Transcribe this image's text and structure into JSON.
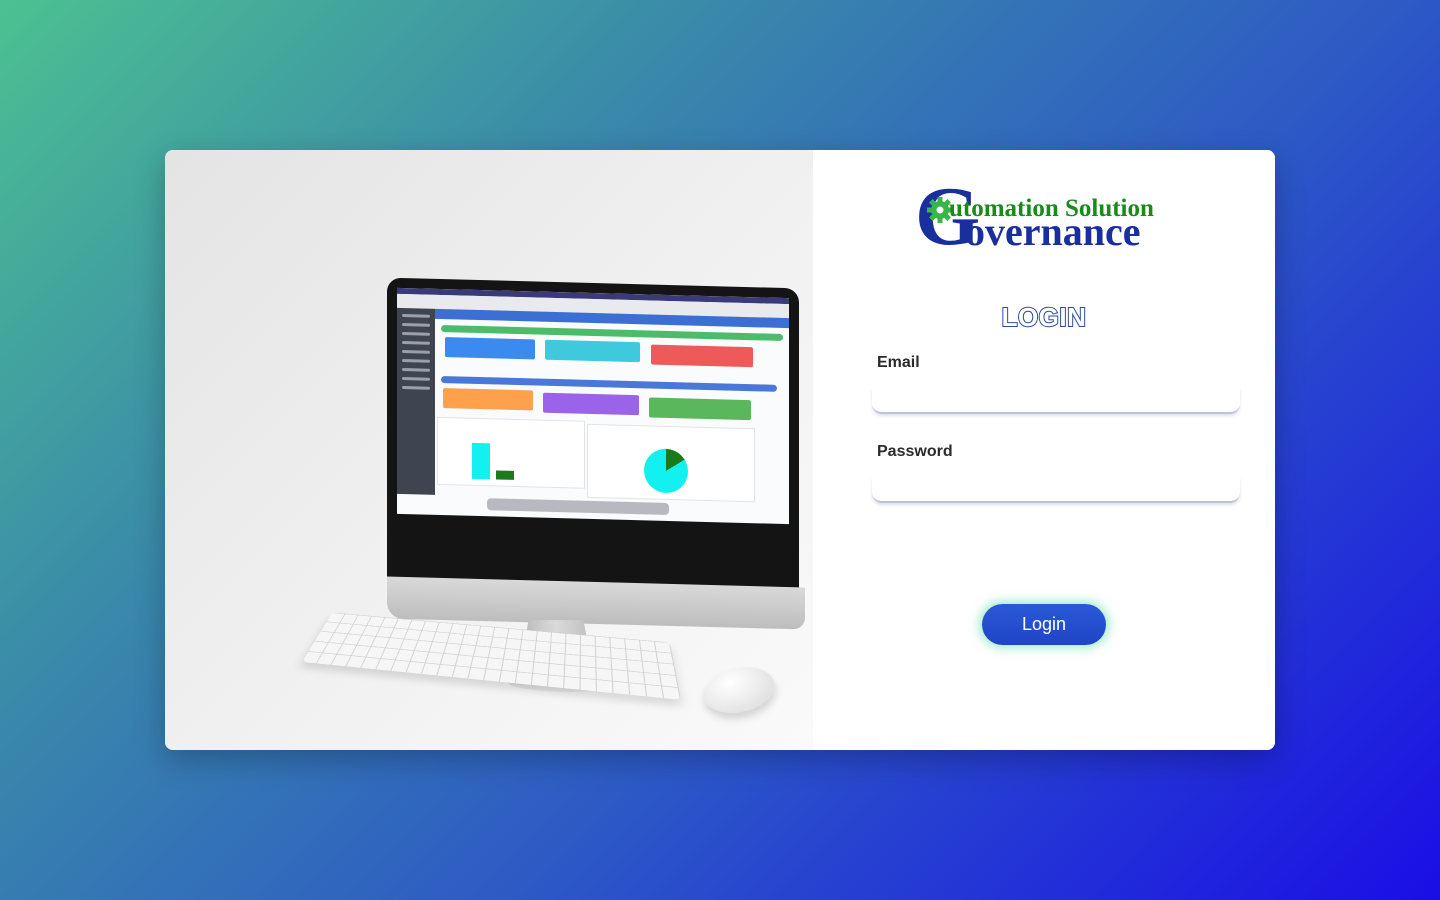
{
  "logo": {
    "line1": "utomation Solution",
    "line2": "overnance",
    "big_letter": "G",
    "line1_color": "#1a8a1a",
    "line2_color": "#1a2f9e",
    "gear_color": "#3ab54a"
  },
  "form": {
    "title": "LOGIN",
    "email_label": "Email",
    "email_value": "",
    "password_label": "Password",
    "password_value": "",
    "submit_label": "Login"
  },
  "colors": {
    "background_gradient": [
      "#4cc191",
      "#1a0ee6"
    ],
    "button": "#2450d0",
    "button_glow": "#50dca0"
  }
}
